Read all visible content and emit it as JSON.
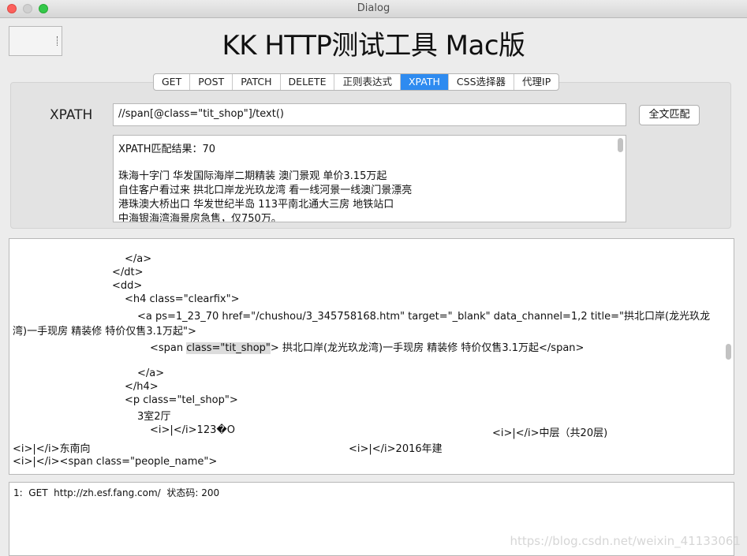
{
  "window": {
    "title": "Dialog"
  },
  "app": {
    "title": "KK HTTP测试工具 Mac版"
  },
  "tabs": [
    "GET",
    "POST",
    "PATCH",
    "DELETE",
    "正则表达式",
    "XPATH",
    "CSS选择器",
    "代理IP"
  ],
  "active_tab": "XPATH",
  "xpath": {
    "label": "XPATH",
    "value": "//span[@class=\"tit_shop\"]/text()",
    "match_button": "全文匹配"
  },
  "result": {
    "lines": [
      "XPATH匹配结果：70",
      "",
      "珠海十字门 华发国际海岸二期精装 澳门景观 单价3.15万起",
      "自住客户看过来 拱北口岸龙光玖龙湾 看一线河景一线澳门景漂亮",
      "港珠澳大桥出口 华发世纪半岛 113平南北通大三房 地铁站口",
      "中海银海湾海景房急售，仅750万。"
    ]
  },
  "code": {
    "lines": [
      "</a>",
      "</dt>",
      "<dd>",
      "<h4 class=\"clearfix\">",
      "<a ps=1_23_70 href=\"/chushou/3_345758168.htm\" target=\"_blank\" data_channel=1,2 title=\"拱北口岸(龙光玖龙",
      "湾)一手现房 精装修 特价仅售3.1万起\">",
      "<span ",
      "class=\"tit_shop\"",
      "> 拱北口岸(龙光玖龙湾)一手现房 精装修 特价仅售3.1万起</span>",
      "</a>",
      "</h4>",
      "<p class=\"tel_shop\">",
      "3室2厅",
      "<i>|</i>123�O",
      "<i>|</i>中层（共20层)",
      "<i>|</i>东南向",
      "<i>|</i>2016年建",
      "<i>|</i><span class=\"people_name\">"
    ]
  },
  "log": {
    "line": "1:  GET  http://zh.esf.fang.com/  状态码: 200"
  },
  "watermark": "https://blog.csdn.net/weixin_41133061"
}
